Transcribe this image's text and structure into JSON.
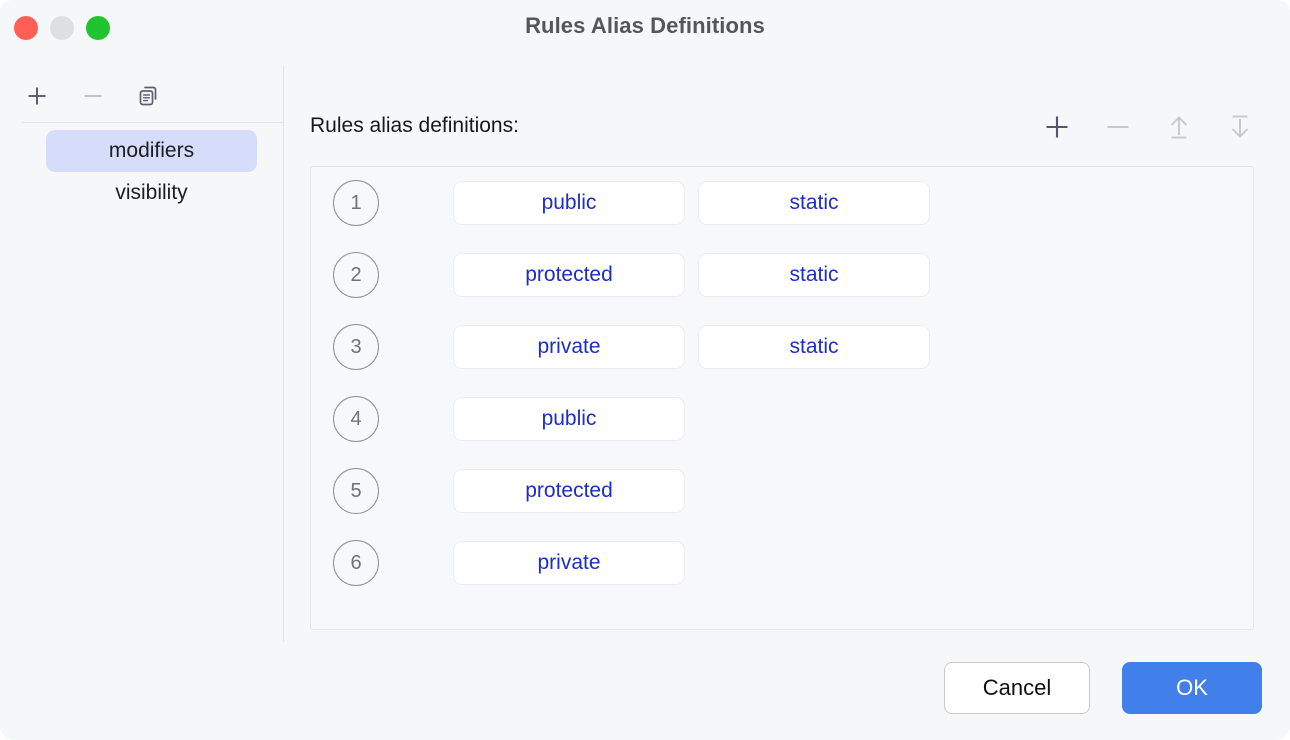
{
  "window": {
    "title": "Rules Alias Definitions",
    "traffic_lights": [
      {
        "name": "close",
        "color": "#ff5f56"
      },
      {
        "name": "minimize",
        "color": "#dedfe1"
      },
      {
        "name": "zoom",
        "color": "#1fc42e"
      }
    ]
  },
  "sidebar": {
    "toolbar": [
      {
        "icon": "plus-icon",
        "enabled": true
      },
      {
        "icon": "minus-icon",
        "enabled": false
      },
      {
        "icon": "copy-icon",
        "enabled": true
      }
    ],
    "items": [
      {
        "label": "modifiers",
        "selected": true
      },
      {
        "label": "visibility",
        "selected": false
      }
    ]
  },
  "main": {
    "label": "Rules alias definitions:",
    "toolbar": [
      {
        "icon": "plus-icon",
        "enabled": true
      },
      {
        "icon": "minus-icon",
        "enabled": false
      },
      {
        "icon": "move-up-icon",
        "enabled": false
      },
      {
        "icon": "move-down-icon",
        "enabled": false
      }
    ],
    "rows": [
      {
        "number": "1",
        "chips": [
          "public",
          "static"
        ]
      },
      {
        "number": "2",
        "chips": [
          "protected",
          "static"
        ]
      },
      {
        "number": "3",
        "chips": [
          "private",
          "static"
        ]
      },
      {
        "number": "4",
        "chips": [
          "public"
        ]
      },
      {
        "number": "5",
        "chips": [
          "protected"
        ]
      },
      {
        "number": "6",
        "chips": [
          "private"
        ]
      }
    ]
  },
  "footer": {
    "cancel_label": "Cancel",
    "ok_label": "OK"
  },
  "colors": {
    "accent": "#4180ea",
    "chip_text": "#1c2fc4",
    "selection": "#d6ddfb",
    "background": "#f6f7f9"
  }
}
